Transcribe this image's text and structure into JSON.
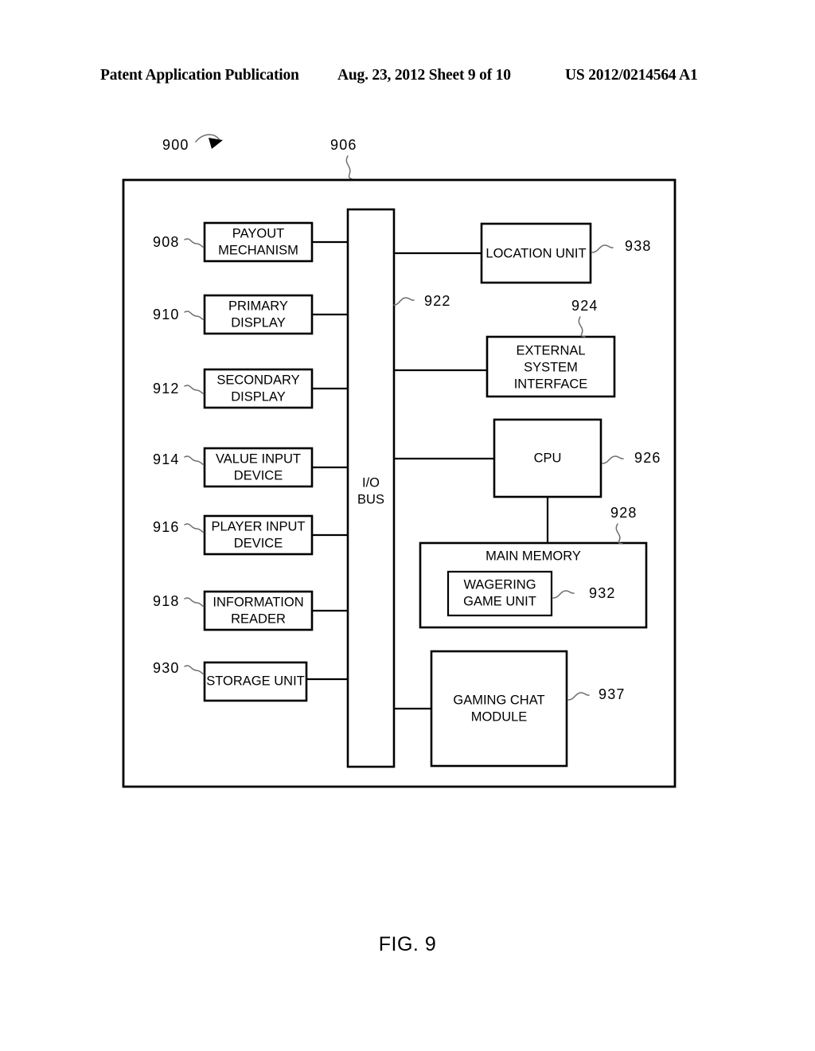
{
  "header": {
    "publication": "Patent Application Publication",
    "date_sheet": "Aug. 23, 2012  Sheet 9 of 10",
    "document_number": "US 2012/0214564 A1"
  },
  "figure": {
    "caption": "FIG. 9",
    "system_ref": "900",
    "enclosure_ref": "906"
  },
  "bus": {
    "line1": "I/O",
    "line2": "BUS",
    "ref": "922"
  },
  "left_blocks": [
    {
      "ref": "908",
      "line1": "PAYOUT",
      "line2": "MECHANISM"
    },
    {
      "ref": "910",
      "line1": "PRIMARY",
      "line2": "DISPLAY"
    },
    {
      "ref": "912",
      "line1": "SECONDARY",
      "line2": "DISPLAY"
    },
    {
      "ref": "914",
      "line1": "VALUE INPUT",
      "line2": "DEVICE"
    },
    {
      "ref": "916",
      "line1": "PLAYER INPUT",
      "line2": "DEVICE"
    },
    {
      "ref": "918",
      "line1": "INFORMATION",
      "line2": "READER"
    },
    {
      "ref": "930",
      "line1": "STORAGE UNIT",
      "line2": ""
    }
  ],
  "right_blocks": [
    {
      "ref": "938",
      "line1": "LOCATION UNIT",
      "line2": "",
      "line3": ""
    },
    {
      "ref": "924",
      "line1": "EXTERNAL",
      "line2": "SYSTEM",
      "line3": "INTERFACE"
    },
    {
      "ref": "926",
      "line1": "CPU",
      "line2": "",
      "line3": ""
    },
    {
      "ref": "937",
      "line1": "GAMING CHAT",
      "line2": "MODULE",
      "line3": ""
    }
  ],
  "memory": {
    "ref": "928",
    "title": "MAIN MEMORY",
    "inner": {
      "ref": "932",
      "line1": "WAGERING",
      "line2": "GAME UNIT"
    }
  },
  "colors": {
    "ink": "#000000",
    "leader": "#6d6d6d",
    "paper": "#ffffff"
  }
}
